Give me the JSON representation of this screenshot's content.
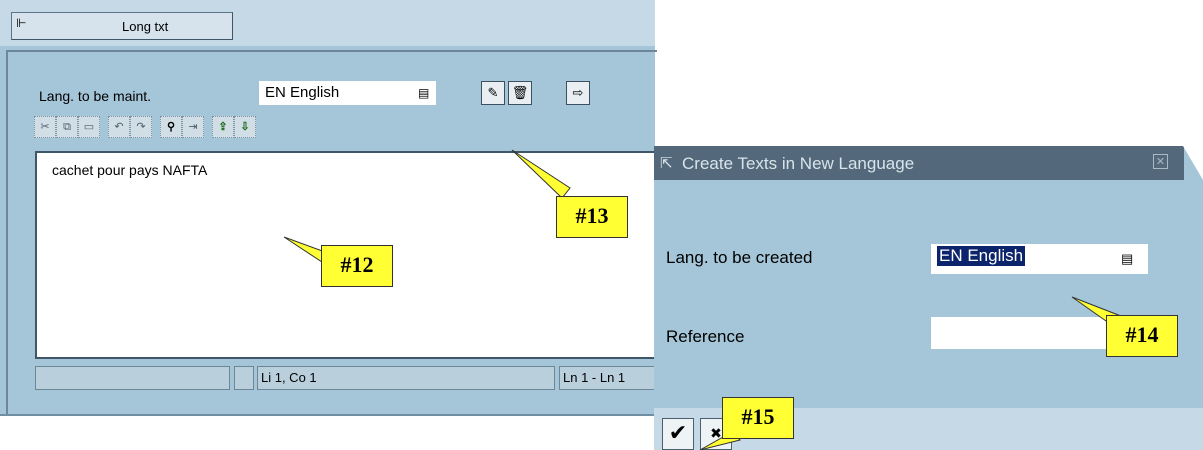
{
  "long_text_window": {
    "title_button": "Long txt",
    "lang_maint_label": "Lang. to be maint.",
    "lang_maint_value": "EN English",
    "editor_text": "cachet pour pays NAFTA",
    "status": {
      "cell1": "",
      "cell2": "",
      "position": "Li 1, Co 1",
      "lines": "Ln 1 - Ln 1"
    }
  },
  "dialog": {
    "title": "Create Texts in New Language",
    "create_label": "Lang. to be created",
    "create_value": "EN English",
    "reference_label": "Reference",
    "reference_value": ""
  },
  "callouts": {
    "c12": "#12",
    "c13": "#13",
    "c14": "#14",
    "c15": "#15"
  },
  "colors": {
    "window_bg": "#a5c6d9",
    "title_bar": "#53687a",
    "callout": "#ffff33",
    "selection": "#0b246b"
  }
}
